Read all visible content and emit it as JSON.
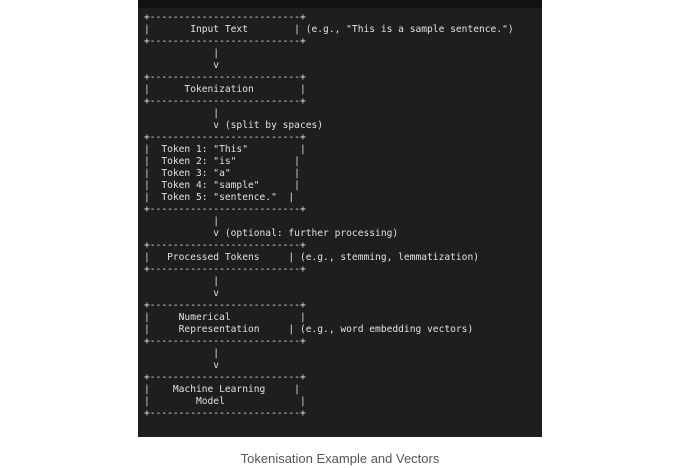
{
  "diagram": {
    "lines": [
      "+--------------------------+",
      "|       Input Text        | (e.g., \"This is a sample sentence.\")",
      "+--------------------------+",
      "            |",
      "            v",
      "+--------------------------+",
      "|      Tokenization        |",
      "+--------------------------+",
      "            |",
      "            v (split by spaces)",
      "+--------------------------+",
      "|  Token 1: \"This\"         |",
      "|  Token 2: \"is\"          |",
      "|  Token 3: \"a\"           |",
      "|  Token 4: \"sample\"      |",
      "|  Token 5: \"sentence.\"  |",
      "+--------------------------+",
      "            |",
      "            v (optional: further processing)",
      "+--------------------------+",
      "|   Processed Tokens     | (e.g., stemming, lemmatization)",
      "+--------------------------+",
      "            |",
      "            v",
      "+--------------------------+",
      "|     Numerical            |",
      "|     Representation     | (e.g., word embedding vectors)",
      "+--------------------------+",
      "            |",
      "            v",
      "+--------------------------+",
      "|    Machine Learning     |",
      "|        Model             |",
      "+--------------------------+"
    ]
  },
  "caption": "Tokenisation Example and Vectors"
}
